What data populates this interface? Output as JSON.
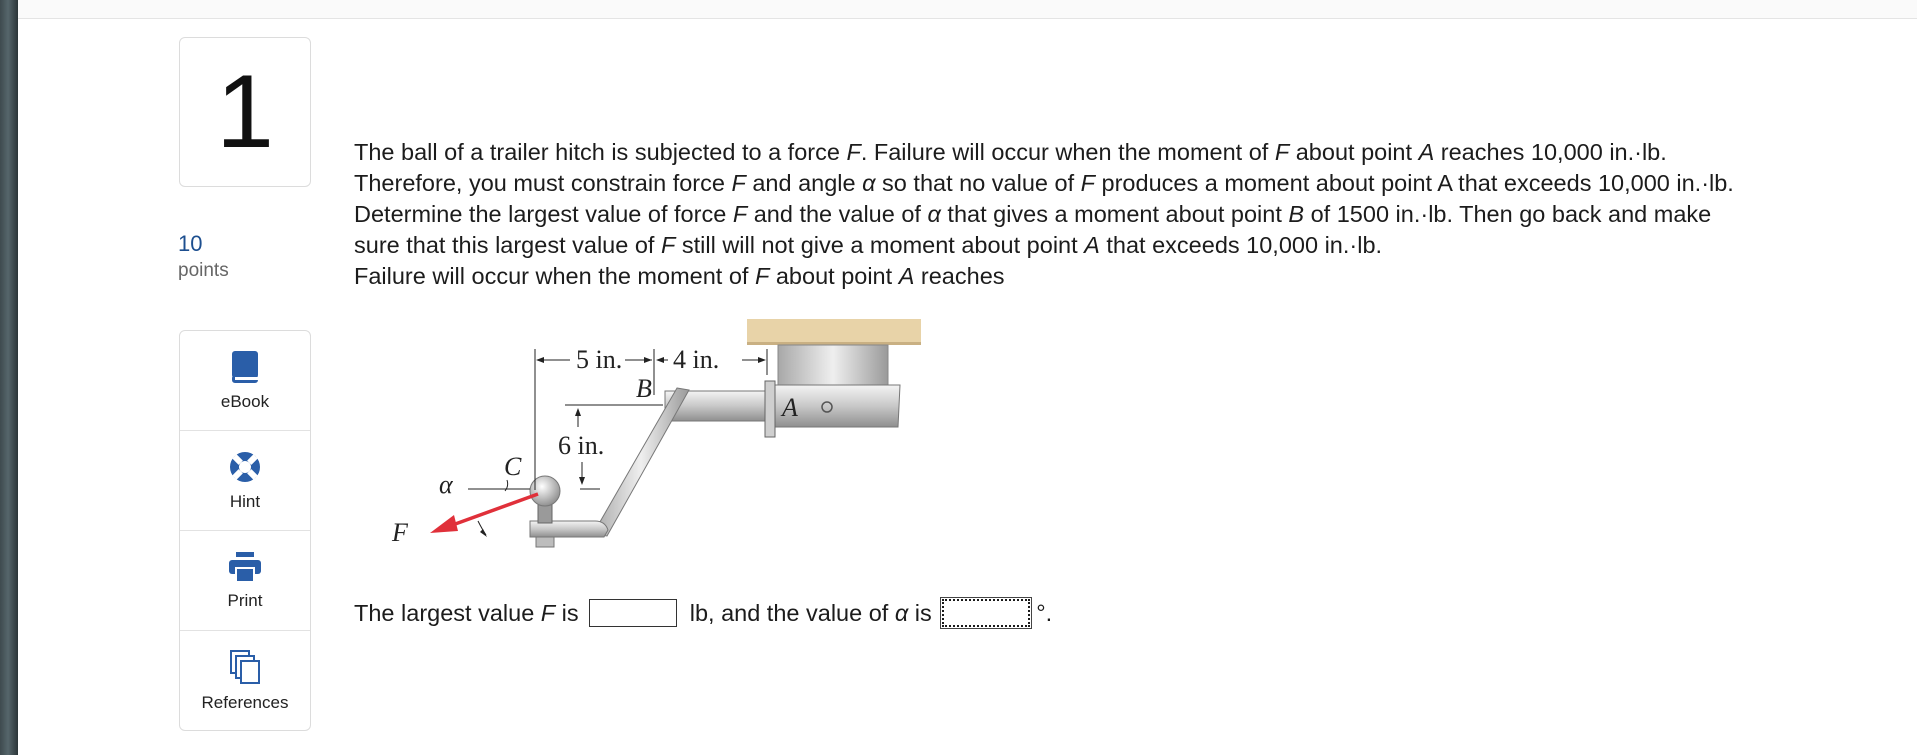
{
  "question": {
    "number": "1",
    "points_value": "10",
    "points_label": "points",
    "line1": [
      "The ball of a trailer hitch is subjected to a force ",
      "F",
      ". Failure will occur when the moment of ",
      "F",
      " about point ",
      "A",
      " reaches 10,000 in.·lb."
    ],
    "line2": [
      "Therefore, you must constrain force ",
      "F",
      " and angle ",
      "α",
      " so that no value of ",
      "F",
      " produces a moment about point A that exceeds 10,000 in.·lb."
    ],
    "line3": [
      "Determine the largest value of force ",
      "F",
      " and the value of ",
      "α",
      " that gives a moment about point ",
      "B",
      " of 1500 in.·lb. Then go back and make"
    ],
    "line4": [
      "sure that this largest value of ",
      "F",
      " still will not give a moment about point ",
      "A",
      " that exceeds 10,000 in.·lb."
    ],
    "line5": [
      "Failure will occur when the moment of ",
      "F",
      " about point ",
      "A",
      " reaches"
    ]
  },
  "tools": [
    {
      "label": "eBook",
      "icon": "book-icon"
    },
    {
      "label": "Hint",
      "icon": "lifebuoy-icon"
    },
    {
      "label": "Print",
      "icon": "printer-icon"
    },
    {
      "label": "References",
      "icon": "documents-icon"
    }
  ],
  "figure": {
    "dim_horizontal_1": "5 in.",
    "dim_horizontal_2": "4 in.",
    "dim_vertical": "6 in.",
    "label_B": "B",
    "label_A": "A",
    "label_C": "C",
    "label_alpha": "α",
    "label_F": "F"
  },
  "answer": {
    "part1": "The largest value ",
    "var_F": "F",
    "part2": " is ",
    "part3": " lb, and the value of ",
    "var_alpha": "α",
    "part4": " is ",
    "unit": "°.",
    "input_F_value": "",
    "input_alpha_value": ""
  },
  "colors": {
    "accent_blue": "#2a5ea8",
    "force_arrow": "#e0303a",
    "beam_tan": "#e8d3a8"
  }
}
